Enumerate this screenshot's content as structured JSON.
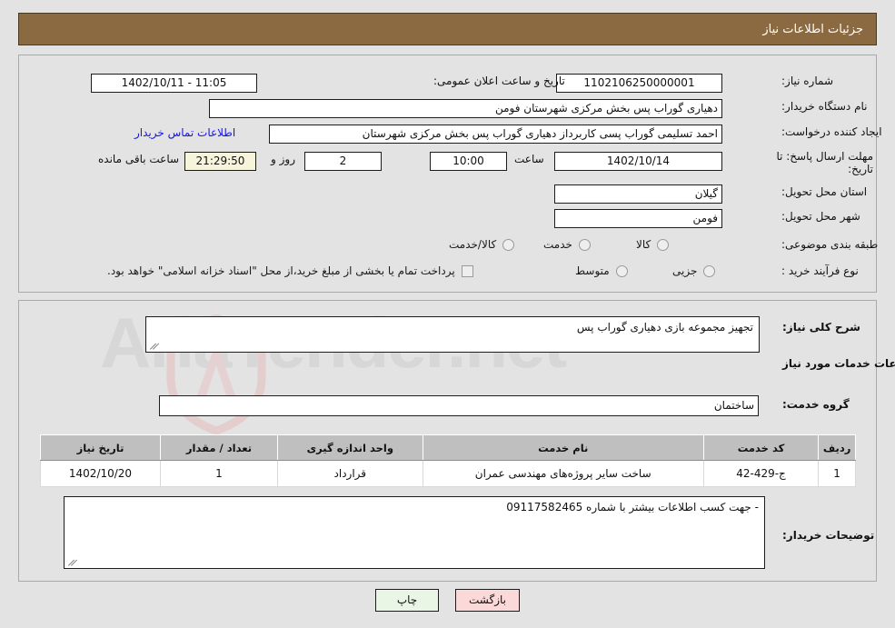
{
  "header": {
    "title": "جزئیات اطلاعات نیاز",
    "bg": "#8b6a42"
  },
  "watermark": {
    "text": "AriaTender.net"
  },
  "top_form": {
    "need_number_label": "شماره نیاز:",
    "need_number_value": "1102106250000001",
    "announce_label": "تاریخ و ساعت اعلان عمومی:",
    "announce_value": "11:05 - 1402/10/11",
    "buyer_org_label": "نام دستگاه خریدار:",
    "buyer_org_value": "دهیاری گوراب پس بخش مرکزی شهرستان فومن",
    "creator_label": "ایجاد کننده درخواست:",
    "creator_value": "احمد تسلیمی گوراب پسی کاربرداز دهیاری گوراب پس بخش مرکزی شهرستان",
    "contact_link": "اطلاعات تماس خریدار",
    "deadline_label_line1": "مهلت ارسال پاسخ: تا",
    "deadline_label_line2": "تاریخ:",
    "deadline_date": "1402/10/14",
    "hour_label": "ساعت",
    "hour_value": "10:00",
    "days_value": "2",
    "days_label": "روز و",
    "timer_value": "21:29:50",
    "remaining_label": "ساعت باقی مانده",
    "province_label": "استان محل تحویل:",
    "province_value": "گیلان",
    "city_label": "شهر محل تحویل:",
    "city_value": "فومن",
    "category_label": "طبقه بندی موضوعی:",
    "category_options": [
      {
        "label": "کالا",
        "selected": false
      },
      {
        "label": "خدمت",
        "selected": false
      },
      {
        "label": "کالا/خدمت",
        "selected": false
      }
    ],
    "process_label": "نوع فرآیند خرید :",
    "process_options": [
      {
        "label": "جزیی",
        "selected": false
      },
      {
        "label": "متوسط",
        "selected": false
      }
    ],
    "treasury_checkbox_label": "پرداخت تمام یا بخشی از مبلغ خرید،از محل \"اسناد خزانه اسلامی\" خواهد بود.",
    "treasury_checked": false
  },
  "bottom": {
    "summary_label": "شرح کلی نیاز:",
    "summary_value": "تجهیز مجموعه بازی دهیاری گوراب پس",
    "services_heading": "اطلاعات خدمات مورد نیاز",
    "service_group_label": "گروه خدمت:",
    "service_group_value": "ساختمان",
    "notes_label": "توضیحات خریدار:",
    "notes_value": "- جهت کسب اطلاعات بیشتر با شماره 09117582465"
  },
  "table": {
    "columns": [
      "ردیف",
      "کد خدمت",
      "نام خدمت",
      "واحد اندازه گیری",
      "تعداد / مقدار",
      "تاریخ نیاز"
    ],
    "rows": [
      {
        "radif": "1",
        "code": "ج-429-42",
        "name": "ساخت سایر پروژه‌های مهندسی عمران",
        "unit": "قرارداد",
        "qty": "1",
        "date": "1402/10/20"
      }
    ]
  },
  "footer": {
    "print_label": "چاپ",
    "back_label": "بازگشت"
  }
}
